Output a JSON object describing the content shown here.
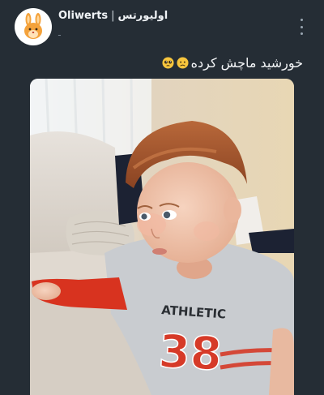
{
  "post": {
    "channel": {
      "name_latin": "Oliwerts",
      "separator": "|",
      "name_persian": "اولیورتس",
      "subline": "ـ"
    },
    "caption": {
      "text": "خورشید ماچش کرده",
      "emojis": [
        "pleading-face-icon",
        "worried-face-icon"
      ]
    },
    "photo": {
      "shirt_text": "ATHLETIC",
      "shirt_number": "38"
    },
    "colors": {
      "background": "#252d35",
      "text": "#f1f4f7",
      "avatar_bg": "#ffffff",
      "avatar_icon": "#f4a23b"
    }
  }
}
